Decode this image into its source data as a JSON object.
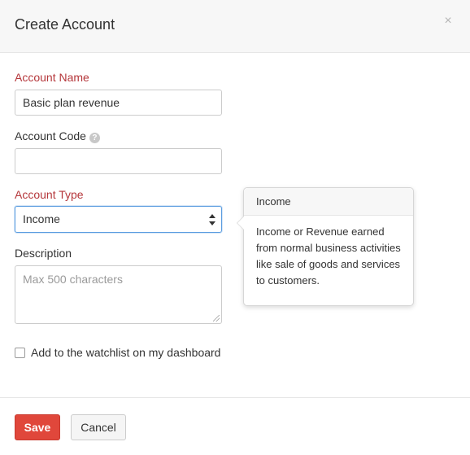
{
  "modal": {
    "title": "Create Account",
    "close_icon": "close-icon"
  },
  "form": {
    "account_name": {
      "label": "Account Name",
      "value": "Basic plan revenue",
      "required": true
    },
    "account_code": {
      "label": "Account Code",
      "help_icon": "help-icon",
      "help_glyph": "?",
      "value": ""
    },
    "account_type": {
      "label": "Account Type",
      "selected": "Income",
      "required": true
    },
    "description": {
      "label": "Description",
      "placeholder": "Max 500 characters"
    },
    "watchlist": {
      "label": "Add to the watchlist on my dashboard",
      "checked": false
    }
  },
  "popover": {
    "title": "Income",
    "body": "Income or Revenue earned from normal business activities like sale of goods and services to customers."
  },
  "footer": {
    "save_label": "Save",
    "cancel_label": "Cancel"
  },
  "colors": {
    "required_label": "#b5373b",
    "primary_button": "#e0473b",
    "focus_border": "#5b9de0"
  }
}
